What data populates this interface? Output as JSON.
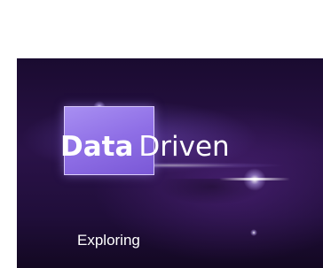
{
  "title": {
    "word_highlighted": "Data",
    "word_plain": "Driven"
  },
  "subtitle": "Exploring",
  "colors": {
    "background": "#1f0d38",
    "highlight_box": "#8f6fe6",
    "text": "#ffffff"
  }
}
